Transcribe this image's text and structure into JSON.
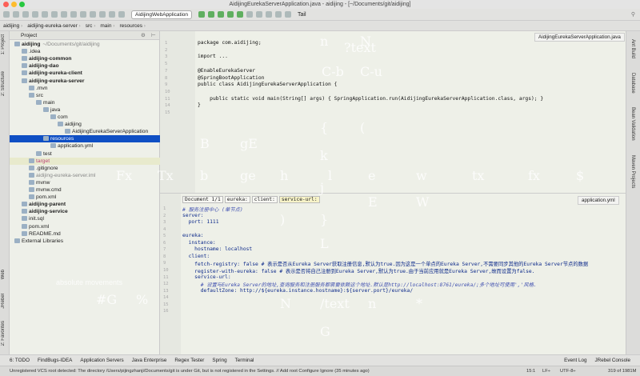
{
  "window": {
    "title": "AidijingEurekaServerApplication.java - aidijing - [~/Documents/git/aidijing]"
  },
  "toolbar": {
    "run_config": "AidijingWebApplication",
    "tail_label": "Tail"
  },
  "breadcrumb": [
    "aidijing",
    "aidijing-eureka-server",
    "src",
    "main",
    "resources"
  ],
  "left_tabs": [
    "1: Project",
    "2: Structure",
    "Web",
    "JRebel",
    "2: Favorites"
  ],
  "right_tabs": [
    "Ant Build",
    "Database",
    "Bean Validation",
    "Maven Projects"
  ],
  "project": {
    "title": "Project",
    "tree": [
      {
        "label": "aidijing",
        "suffix": "~/Documents/git/aidijing",
        "depth": 0,
        "bold": true
      },
      {
        "label": ".idea",
        "depth": 1
      },
      {
        "label": "aidijing-common",
        "depth": 1,
        "bold": true
      },
      {
        "label": "aidijing-dao",
        "depth": 1,
        "bold": true
      },
      {
        "label": "aidijing-eureka-client",
        "depth": 1,
        "bold": true
      },
      {
        "label": "aidijing-eureka-server",
        "depth": 1,
        "bold": true
      },
      {
        "label": ".mvn",
        "depth": 2
      },
      {
        "label": "src",
        "depth": 2
      },
      {
        "label": "main",
        "depth": 3
      },
      {
        "label": "java",
        "depth": 4
      },
      {
        "label": "com",
        "depth": 5
      },
      {
        "label": "aidijing",
        "depth": 6
      },
      {
        "label": "AidijingEurekaServerApplication",
        "depth": 7
      },
      {
        "label": "resources",
        "depth": 4,
        "selected": true
      },
      {
        "label": "application.yml",
        "depth": 5
      },
      {
        "label": "test",
        "depth": 3
      },
      {
        "label": "target",
        "depth": 2,
        "target": true
      },
      {
        "label": ".gitignore",
        "depth": 2
      },
      {
        "label": "aidijing-eureka-server.iml",
        "depth": 2,
        "dim": true
      },
      {
        "label": "mvnw",
        "depth": 2
      },
      {
        "label": "mvnw.cmd",
        "depth": 2
      },
      {
        "label": "pom.xml",
        "depth": 2
      },
      {
        "label": "aidijing-parent",
        "depth": 1,
        "bold": true
      },
      {
        "label": "aidijing-service",
        "depth": 1,
        "bold": true
      },
      {
        "label": "init.sql",
        "depth": 1
      },
      {
        "label": "pom.xml",
        "depth": 1
      },
      {
        "label": "README.md",
        "depth": 1
      },
      {
        "label": "External Libraries",
        "depth": 0
      }
    ]
  },
  "editor_top": {
    "tab": "AidijingEurekaServerApplication.java",
    "lines": [
      {
        "n": "1",
        "t": "package com.aidijing;"
      },
      {
        "n": "2",
        "t": ""
      },
      {
        "n": "3",
        "t": "import ..."
      },
      {
        "n": "5",
        "t": ""
      },
      {
        "n": "7",
        "t": "@EnableEurekaServer"
      },
      {
        "n": "8",
        "t": "@SpringBootApplication"
      },
      {
        "n": "9",
        "t": "public class AidijingEurekaServerApplication {"
      },
      {
        "n": "10",
        "t": ""
      },
      {
        "n": "11",
        "t": "    public static void main(String[] args) { SpringApplication.run(AidijingEurekaServerApplication.class, args); }"
      },
      {
        "n": "14",
        "t": "}"
      },
      {
        "n": "15",
        "t": ""
      }
    ]
  },
  "editor_bottom": {
    "tab": "application.yml",
    "crumbs": [
      "Document 1/1",
      "eureka:",
      "client:",
      "service-url:"
    ],
    "lines": [
      {
        "n": "1",
        "t": "# 服务注册中心 (单节点)",
        "c": "cm"
      },
      {
        "n": "2",
        "t": "server:",
        "c": "key"
      },
      {
        "n": "3",
        "t": "  port: 1111",
        "c": "key"
      },
      {
        "n": "4",
        "t": "",
        "c": ""
      },
      {
        "n": "5",
        "t": "eureka:",
        "c": "key"
      },
      {
        "n": "6",
        "t": "  instance:",
        "c": "key"
      },
      {
        "n": "7",
        "t": "    hostname: localhost",
        "c": "key"
      },
      {
        "n": "8",
        "t": "  client:",
        "c": "key"
      },
      {
        "n": "9",
        "t": "    fetch-registry: false # 表示是否从Eureka Server获取注册信息,默认为true.因为这是一个单点的Eureka Server,不需要同步其他的Eureka Server节点的数据",
        "c": "key"
      },
      {
        "n": "10",
        "t": "    register-with-eureka: false # 表示是否将自己注册到Eureka Server,默认为true.由于当前应用就是Eureka Server,故而设置为false.",
        "c": "key"
      },
      {
        "n": "11",
        "t": "    service-url:",
        "c": "key"
      },
      {
        "n": "12",
        "t": "      # 设置与Eureka Server的地址,查询服务和注册服务都需要依赖这个地址.默认是http://localhost:8761/eureka/;多个地址可使用','风格.",
        "c": "cm"
      },
      {
        "n": "13",
        "t": "      defaultZone: http://${eureka.instance.hostname}:${server.port}/eureka/",
        "c": "key"
      },
      {
        "n": "14",
        "t": "",
        "c": ""
      },
      {
        "n": "15",
        "t": "",
        "c": ""
      },
      {
        "n": "16",
        "t": "",
        "c": ""
      }
    ]
  },
  "overlay": [
    "?text",
    "n",
    "N",
    "C-b",
    "C-u",
    "{",
    "(",
    "k",
    "B",
    "gE",
    "Fx",
    "Tx",
    "b",
    "ge",
    "h",
    "l",
    "e",
    "w",
    "tx",
    "fx",
    "$",
    "j",
    "E",
    "W",
    "}",
    ")",
    "L",
    "N",
    "/text",
    "n",
    "*",
    "G",
    "#G",
    "%",
    "absolute movements"
  ],
  "bottom_tools": [
    "6: TODO",
    "FindBugs-IDEA",
    "Application Servers",
    "Java Enterprise",
    "Regex Tester",
    "Spring",
    "Terminal",
    "Event Log",
    "JRebel Console"
  ],
  "status": {
    "message": "Unregistered VCS root detected: The directory /Users/pijingzhanji/Documents/git is under Git, but is not registered in the Settings. // Add root  Configure  Ignore (35 minutes ago)",
    "position": "15:1",
    "line_sep": "LF÷",
    "encoding": "UTF-8÷",
    "memory": "319 of 1981M"
  }
}
